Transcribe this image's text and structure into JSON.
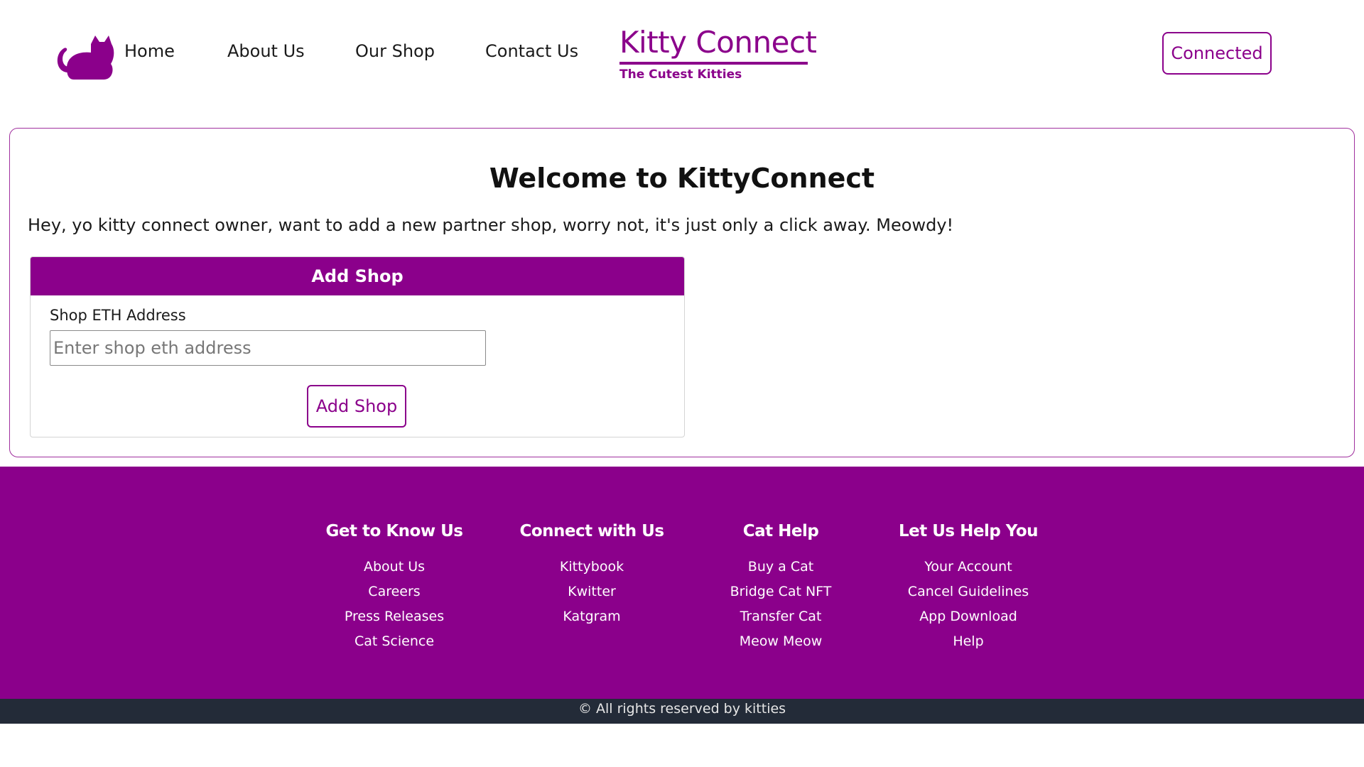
{
  "header": {
    "logo_icon": "cat-silhouette-icon",
    "nav": [
      {
        "label": "Home"
      },
      {
        "label": "About Us"
      },
      {
        "label": "Our Shop"
      },
      {
        "label": "Contact Us"
      }
    ],
    "brand_title": "Kitty Connect",
    "brand_subtitle": "The Cutest Kitties",
    "connect_label": "Connected"
  },
  "main": {
    "title": "Welcome to KittyConnect",
    "intro": "Hey, yo kitty connect owner, want to add a new partner shop, worry not, it's just only a click away. Meowdy!",
    "add_shop": {
      "header": "Add Shop",
      "field_label": "Shop ETH Address",
      "input_value": "",
      "input_placeholder": "Enter shop eth address",
      "button_label": "Add Shop"
    }
  },
  "footer": {
    "columns": [
      {
        "heading": "Get to Know Us",
        "links": [
          "About Us",
          "Careers",
          "Press Releases",
          "Cat Science"
        ]
      },
      {
        "heading": "Connect with Us",
        "links": [
          "Kittybook",
          "Kwitter",
          "Katgram"
        ]
      },
      {
        "heading": "Cat Help",
        "links": [
          "Buy a Cat",
          "Bridge Cat NFT",
          "Transfer Cat",
          "Meow Meow"
        ]
      },
      {
        "heading": "Let Us Help You",
        "links": [
          "Your Account",
          "Cancel Guidelines",
          "App Download",
          "Help"
        ]
      }
    ],
    "copyright": "© All rights reserved by kitties"
  },
  "colors": {
    "accent": "#8b008b",
    "copyright_bar": "#232b38"
  }
}
